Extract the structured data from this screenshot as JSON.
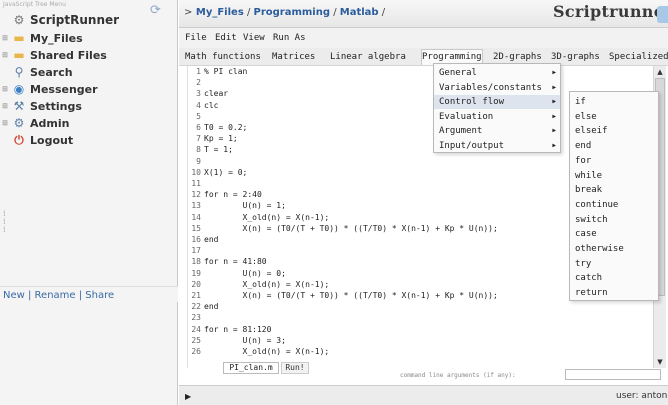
{
  "sidebar": {
    "header": "JavaScript Tree Menu",
    "items": [
      {
        "label": "ScriptRunner",
        "icon": "gear-icon"
      },
      {
        "label": "My_Files",
        "icon": "folder-icon"
      },
      {
        "label": "Shared Files",
        "icon": "folder-icon"
      },
      {
        "label": "Search",
        "icon": "magnifier-icon"
      },
      {
        "label": "Messenger",
        "icon": "globe-icon"
      },
      {
        "label": "Settings",
        "icon": "wrench-icon"
      },
      {
        "label": "Admin",
        "icon": "gear-icon"
      },
      {
        "label": "Logout",
        "icon": "logout-icon"
      }
    ],
    "footer": {
      "new": "New",
      "rename": "Rename",
      "share": "Share",
      "sep": " | "
    }
  },
  "header": {
    "prefix": ">",
    "crumbs": [
      "My_Files",
      "Programming",
      "Matlab"
    ],
    "sep": " / ",
    "brand": "Scriptrunner"
  },
  "menubar": [
    "File",
    "Edit",
    "View",
    "Run As"
  ],
  "toolbar": [
    "Math functions",
    "Matrices",
    "Linear algebra",
    "Programming",
    "2D-graphs",
    "3D-graphs",
    "Specialized"
  ],
  "programming_menu": [
    "General",
    "Variables/constants",
    "Control flow",
    "Evaluation",
    "Argument",
    "Input/output"
  ],
  "control_flow_menu": [
    "if",
    "else",
    "elseif",
    "end",
    "for",
    "while",
    "break",
    "continue",
    "switch",
    "case",
    "otherwise",
    "try",
    "catch",
    "return"
  ],
  "code": [
    {
      "n": "1",
      "t": "% PI clan"
    },
    {
      "n": "2",
      "t": ""
    },
    {
      "n": "3",
      "t": "clear"
    },
    {
      "n": "4",
      "t": "clc"
    },
    {
      "n": "5",
      "t": ""
    },
    {
      "n": "6",
      "t": "T0 = 0.2;"
    },
    {
      "n": "7",
      "t": "Kp = 1;"
    },
    {
      "n": "8",
      "t": "T = 1;"
    },
    {
      "n": "9",
      "t": ""
    },
    {
      "n": "10",
      "t": "X(1) = 0;"
    },
    {
      "n": "11",
      "t": ""
    },
    {
      "n": "12",
      "t": "for n = 2:40"
    },
    {
      "n": "13",
      "t": "        U(n) = 1;"
    },
    {
      "n": "14",
      "t": "        X_old(n) = X(n-1);"
    },
    {
      "n": "15",
      "t": "        X(n) = (T0/(T + T0)) * ((T/T0) * X(n-1) + Kp * U(n));"
    },
    {
      "n": "16",
      "t": "end"
    },
    {
      "n": "17",
      "t": ""
    },
    {
      "n": "18",
      "t": "for n = 41:80"
    },
    {
      "n": "19",
      "t": "        U(n) = 0;"
    },
    {
      "n": "20",
      "t": "        X_old(n) = X(n-1);"
    },
    {
      "n": "21",
      "t": "        X(n) = (T0/(T + T0)) * ((T/T0) * X(n-1) + Kp * U(n));"
    },
    {
      "n": "22",
      "t": "end"
    },
    {
      "n": "23",
      "t": ""
    },
    {
      "n": "24",
      "t": "for n = 81:120"
    },
    {
      "n": "25",
      "t": "        U(n) = 3;"
    },
    {
      "n": "26",
      "t": "        X_old(n) = X(n-1);"
    }
  ],
  "file_tabs": {
    "file": "PI_clan.m",
    "run": "Run!"
  },
  "args_label": "command line arguments (if any):",
  "status": {
    "play": "▶",
    "user": "user: antoni"
  },
  "colors": {
    "link": "#2b5c9d",
    "menu_highlight": "#dde4ee"
  }
}
